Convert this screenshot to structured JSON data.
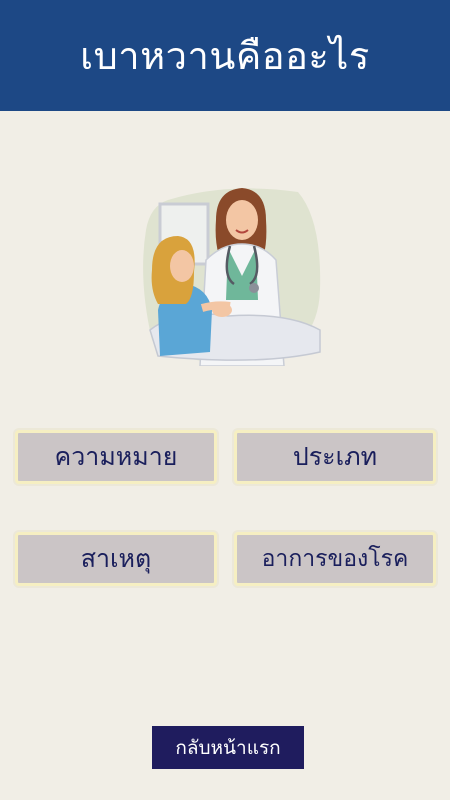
{
  "header": {
    "title": "เบาหวานคืออะไร"
  },
  "illustration": {
    "subject": "doctor-comforting-patient"
  },
  "menu": {
    "meaning": "ความหมาย",
    "types": "ประเภท",
    "causes": "สาเหตุ",
    "symptoms": "อาการของโรค"
  },
  "footer": {
    "home_label": "กลับหน้าแรก"
  },
  "colors": {
    "header_bg": "#1d4885",
    "page_bg": "#f1eee6",
    "button_bg": "#cbc5c6",
    "button_text": "#1a1f5c",
    "home_bg": "#1f1c5e"
  }
}
